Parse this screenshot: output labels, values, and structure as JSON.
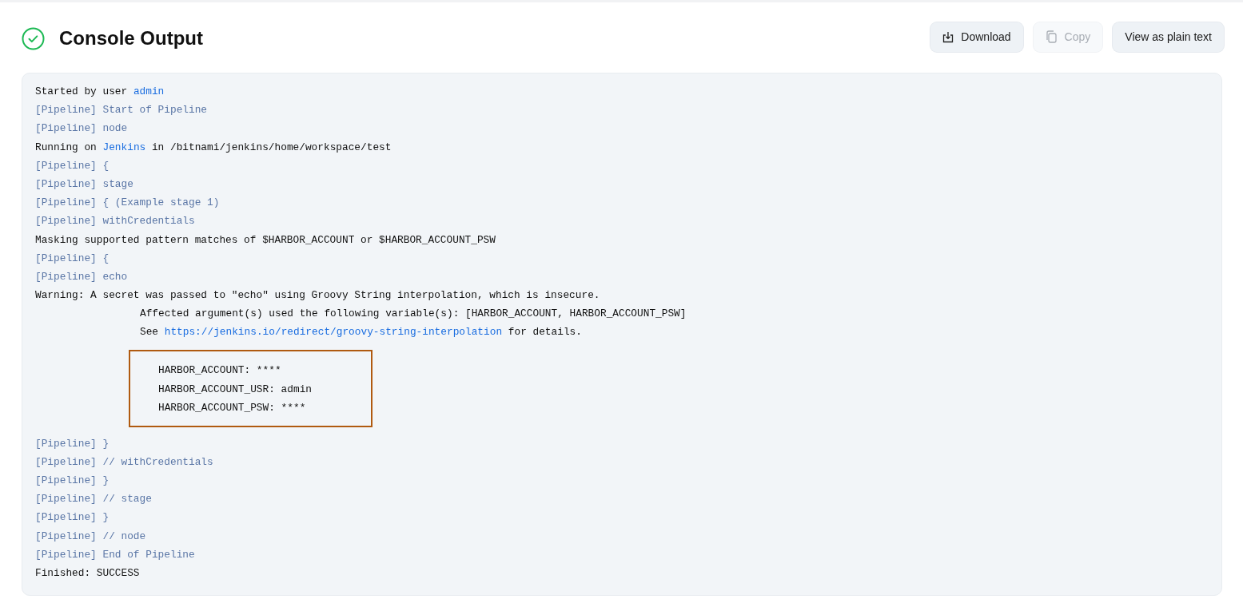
{
  "header": {
    "title": "Console Output",
    "success": true
  },
  "buttons": [
    {
      "kind": "download",
      "label": "Download",
      "disabled": false
    },
    {
      "kind": "copy",
      "label": "Copy",
      "disabled": true
    },
    {
      "kind": "plain",
      "label": "View as plain text",
      "disabled": false
    }
  ],
  "log": [
    {
      "kind": "plain",
      "parts": [
        {
          "text": "Started by user "
        },
        {
          "text": "admin",
          "link": true
        }
      ]
    },
    {
      "kind": "pipeline",
      "parts": [
        {
          "text": "[Pipeline] Start of Pipeline"
        }
      ]
    },
    {
      "kind": "pipeline",
      "parts": [
        {
          "text": "[Pipeline] node"
        }
      ]
    },
    {
      "kind": "plain",
      "parts": [
        {
          "text": "Running on "
        },
        {
          "text": "Jenkins",
          "link": true
        },
        {
          "text": " in /bitnami/jenkins/home/workspace/test"
        }
      ]
    },
    {
      "kind": "pipeline",
      "parts": [
        {
          "text": "[Pipeline] {"
        }
      ]
    },
    {
      "kind": "pipeline",
      "parts": [
        {
          "text": "[Pipeline] stage"
        }
      ]
    },
    {
      "kind": "pipeline",
      "parts": [
        {
          "text": "[Pipeline] { (Example stage 1)"
        }
      ]
    },
    {
      "kind": "pipeline",
      "parts": [
        {
          "text": "[Pipeline] withCredentials"
        }
      ]
    },
    {
      "kind": "plain",
      "parts": [
        {
          "text": "Masking supported pattern matches of $HARBOR_ACCOUNT or $HARBOR_ACCOUNT_PSW"
        }
      ]
    },
    {
      "kind": "pipeline",
      "parts": [
        {
          "text": "[Pipeline] {"
        }
      ]
    },
    {
      "kind": "pipeline",
      "parts": [
        {
          "text": "[Pipeline] echo"
        }
      ]
    },
    {
      "kind": "plain",
      "parts": [
        {
          "text": "Warning: A secret was passed to \"echo\" using Groovy String interpolation, which is insecure."
        }
      ]
    },
    {
      "kind": "continuation",
      "parts": [
        {
          "text": "Affected argument(s) used the following variable(s): [HARBOR_ACCOUNT, HARBOR_ACCOUNT_PSW]"
        }
      ]
    },
    {
      "kind": "continuation",
      "parts": [
        {
          "text": "See "
        },
        {
          "text": "https://jenkins.io/redirect/groovy-string-interpolation",
          "link": true
        },
        {
          "text": " for details."
        }
      ]
    },
    {
      "kind": "highlighted",
      "lines": [
        "HARBOR_ACCOUNT: ****",
        "HARBOR_ACCOUNT_USR: admin",
        "HARBOR_ACCOUNT_PSW: ****"
      ]
    },
    {
      "kind": "pipeline",
      "parts": [
        {
          "text": "[Pipeline] }"
        }
      ]
    },
    {
      "kind": "pipeline",
      "parts": [
        {
          "text": "[Pipeline] // withCredentials"
        }
      ]
    },
    {
      "kind": "pipeline",
      "parts": [
        {
          "text": "[Pipeline] }"
        }
      ]
    },
    {
      "kind": "pipeline",
      "parts": [
        {
          "text": "[Pipeline] // stage"
        }
      ]
    },
    {
      "kind": "pipeline",
      "parts": [
        {
          "text": "[Pipeline] }"
        }
      ]
    },
    {
      "kind": "pipeline",
      "parts": [
        {
          "text": "[Pipeline] // node"
        }
      ]
    },
    {
      "kind": "pipeline",
      "parts": [
        {
          "text": "[Pipeline] End of Pipeline"
        }
      ]
    },
    {
      "kind": "plain",
      "parts": [
        {
          "text": "Finished: SUCCESS"
        }
      ]
    }
  ]
}
